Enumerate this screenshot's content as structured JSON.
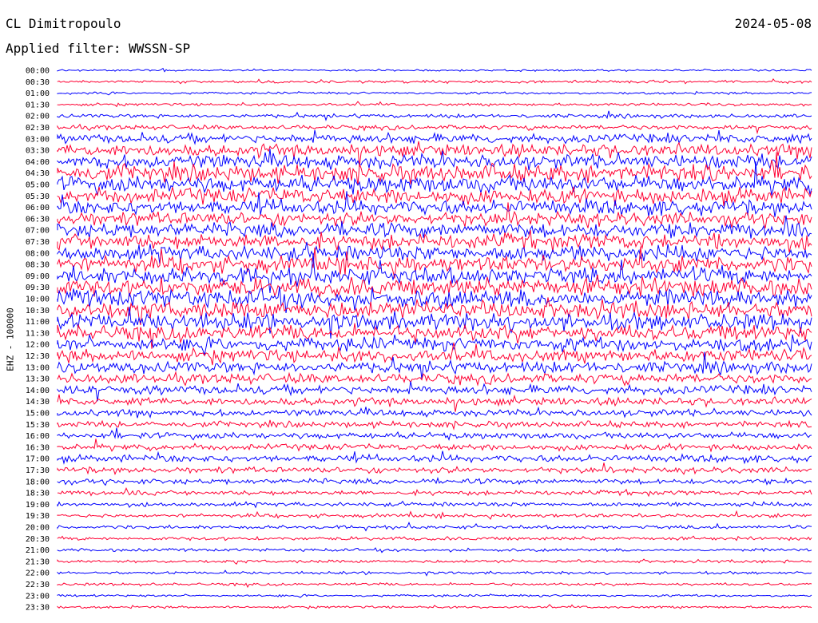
{
  "header": {
    "station": "CL Dimitropoulo",
    "filter_label": "Applied filter: WWSSN-SP",
    "date": "2024-05-08"
  },
  "channel_label": "EHZ - 100000",
  "colors": {
    "trace_a": "#0000ff",
    "trace_b": "#ff0033",
    "background": "#ffffff"
  },
  "chart_data": {
    "type": "line",
    "row_labels": [
      "00:00",
      "00:30",
      "01:00",
      "01:30",
      "02:00",
      "02:30",
      "03:00",
      "03:30",
      "04:00",
      "04:30",
      "05:00",
      "05:30",
      "06:00",
      "06:30",
      "07:00",
      "07:30",
      "08:00",
      "08:30",
      "09:00",
      "09:30",
      "10:00",
      "10:30",
      "11:00",
      "11:30",
      "12:00",
      "12:30",
      "13:00",
      "13:30",
      "14:00",
      "14:30",
      "15:00",
      "15:30",
      "16:00",
      "16:30",
      "17:00",
      "17:30",
      "18:00",
      "18:30",
      "19:00",
      "19:30",
      "20:00",
      "20:30",
      "21:00",
      "21:30",
      "22:00",
      "22:30",
      "23:00",
      "23:30"
    ],
    "row_noise": [
      0.25,
      0.35,
      0.3,
      0.35,
      0.5,
      0.6,
      1.2,
      1.6,
      1.9,
      2.2,
      2.2,
      2.0,
      1.9,
      1.8,
      1.9,
      2.0,
      2.0,
      2.1,
      2.2,
      2.3,
      2.4,
      2.3,
      2.2,
      2.0,
      1.8,
      1.6,
      1.5,
      1.3,
      1.2,
      1.0,
      0.9,
      0.8,
      0.85,
      0.8,
      0.9,
      0.8,
      0.7,
      0.6,
      0.55,
      0.5,
      0.45,
      0.45,
      0.4,
      0.4,
      0.35,
      0.35,
      0.3,
      0.3
    ],
    "x_range_minutes": [
      0,
      30
    ]
  }
}
